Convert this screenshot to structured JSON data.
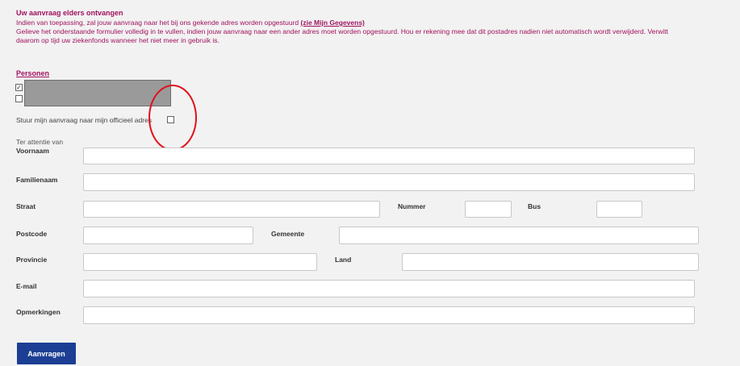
{
  "notice": {
    "title": "Uw aanvraag elders ontvangen",
    "line1_text": "Indien van toepassing, zal jouw aanvraag naar het bij ons gekende adres worden opgestuurd",
    "line1_link": "(zie Mijn Gegevens)",
    "line2": "Gelieve het onderstaande formulier volledig in te vullen, indien jouw aanvraag naar een ander adres moet worden opgestuurd. Hou er rekening mee dat dit postadres nadien niet automatisch wordt verwijderd. Verwitt",
    "line3": "daarom op tijd uw ziekenfonds wanneer het niet meer in gebruik is."
  },
  "persons": {
    "title": "Personen",
    "items": [
      {
        "checked": true,
        "mark": "✓"
      },
      {
        "checked": false,
        "mark": ""
      }
    ]
  },
  "official_address": {
    "label": "Stuur mijn aanvraag naar mijn officieel adres",
    "checked": false
  },
  "attention_label": "Ter attentie van",
  "form": {
    "first_name": {
      "label": "Voornaam",
      "value": ""
    },
    "last_name": {
      "label": "Familienaam",
      "value": ""
    },
    "street": {
      "label": "Straat",
      "value": ""
    },
    "number": {
      "label": "Nummer",
      "value": ""
    },
    "box": {
      "label": "Bus",
      "value": ""
    },
    "postcode": {
      "label": "Postcode",
      "value": ""
    },
    "municipality": {
      "label": "Gemeente",
      "value": ""
    },
    "province": {
      "label": "Provincie",
      "value": ""
    },
    "country": {
      "label": "Land",
      "value": ""
    },
    "email": {
      "label": "E-mail",
      "value": ""
    },
    "remarks": {
      "label": "Opmerkingen",
      "value": ""
    }
  },
  "submit_label": "Aanvragen",
  "colors": {
    "accent": "#a0125e",
    "button": "#1c3f95",
    "annotation": "#e0101a"
  }
}
